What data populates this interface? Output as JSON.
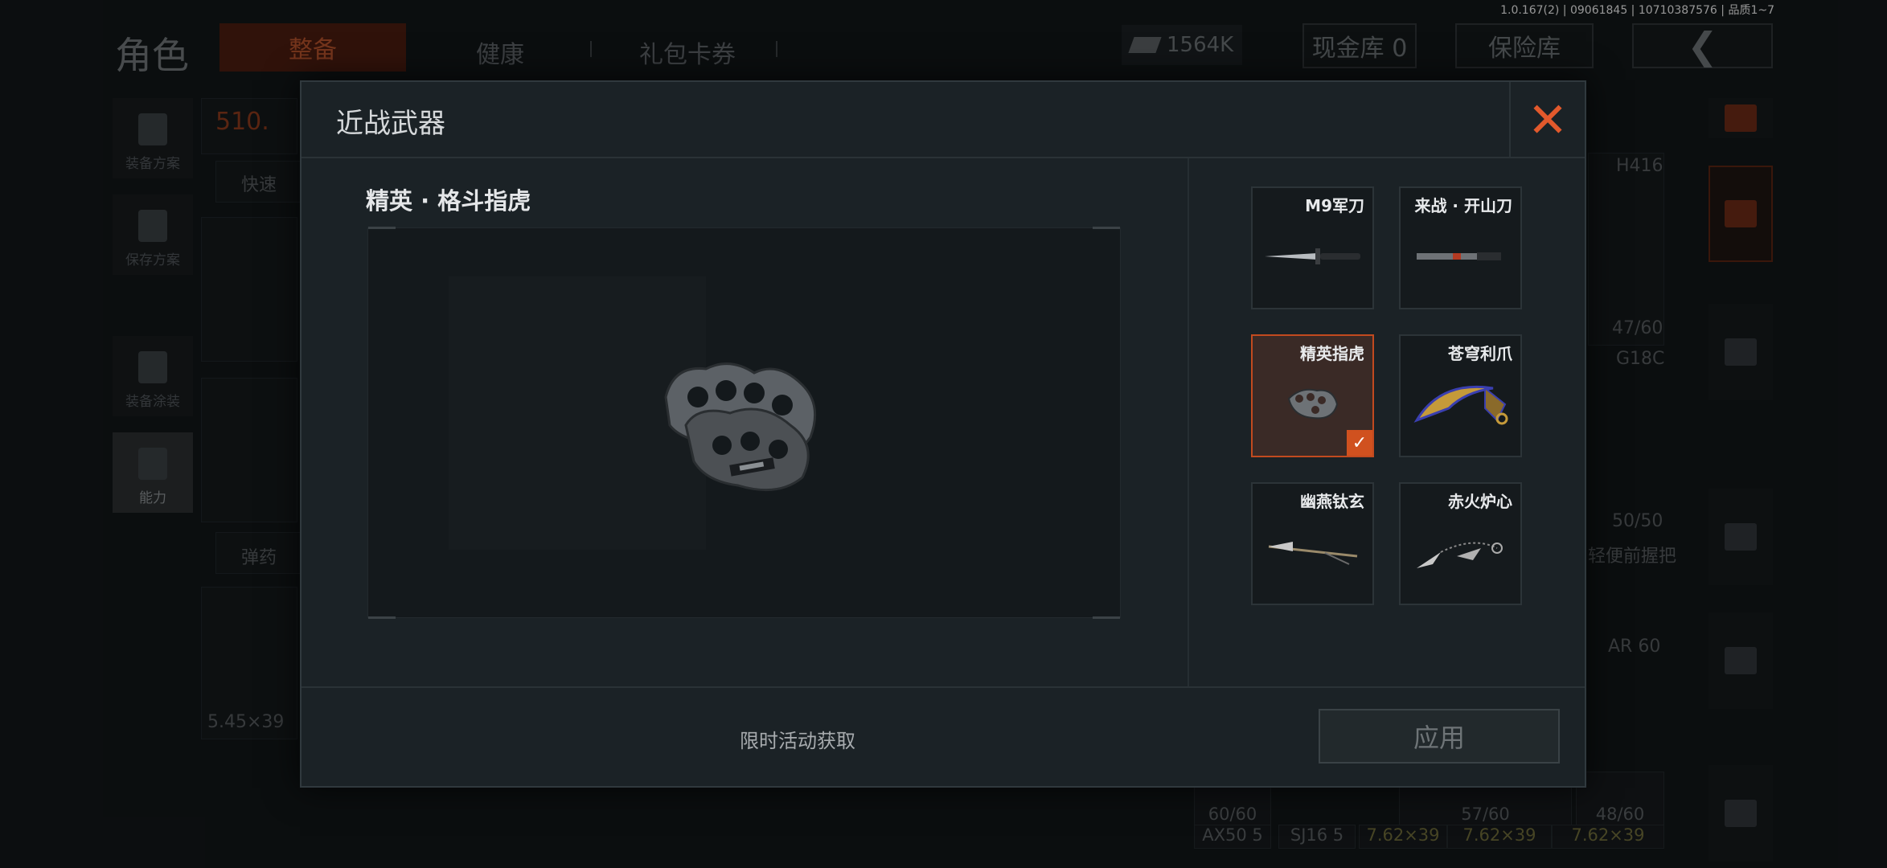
{
  "version": "1.0.167(2) | 09061845 | 10710387576 | 品质1~7",
  "topnav": {
    "title": "角色",
    "tabs": [
      "整备",
      "健康",
      "礼包卡券"
    ],
    "money": "1564K",
    "cash_vault": "现金库 0",
    "safe_box": "保险库",
    "back_icon": "chevron-left-icon"
  },
  "leftbar": {
    "items": [
      {
        "label": "装备方案",
        "icon": "vest-icon"
      },
      {
        "label": "保存方案",
        "icon": "download-icon"
      },
      {
        "label": "装备涂装",
        "icon": "helmet-icon"
      },
      {
        "label": "能力",
        "icon": "lightning-icon"
      }
    ]
  },
  "background": {
    "weight": "510.",
    "quick": "快速",
    "ammo": "弹药",
    "caliber": "5.45×39",
    "h416": "H416",
    "cap1": "47/60",
    "g18c": "G18C",
    "cap2": "50/50",
    "grip": "轻便前握把",
    "ar60": "AR 60",
    "bottom": [
      "60/60",
      "57/60",
      "48/60"
    ],
    "bottom_names": [
      "AX50 5",
      "SJ16 5",
      "7.62×39",
      "7.62×39",
      "7.62×39"
    ]
  },
  "modal": {
    "title": "近战武器",
    "close_icon": "close-icon",
    "selected_name": "精英 · 格斗指虎",
    "items": [
      {
        "label": "M9军刀",
        "icon": "bayonet-icon"
      },
      {
        "label": "来战 · 开山刀",
        "icon": "machete-icon"
      },
      {
        "label": "精英指虎",
        "icon": "knuckles-icon",
        "selected": true
      },
      {
        "label": "苍穹利爪",
        "icon": "karambit-icon"
      },
      {
        "label": "幽燕钛玄",
        "icon": "spear-icon"
      },
      {
        "label": "赤火炉心",
        "icon": "chain-blade-icon"
      }
    ],
    "source": "限时活动获取",
    "apply": "应用",
    "check_icon": "checkmark-icon"
  },
  "colors": {
    "accent": "#e2592c",
    "selected_border": "#c24a1f",
    "modal_bg": "#1b2226"
  }
}
